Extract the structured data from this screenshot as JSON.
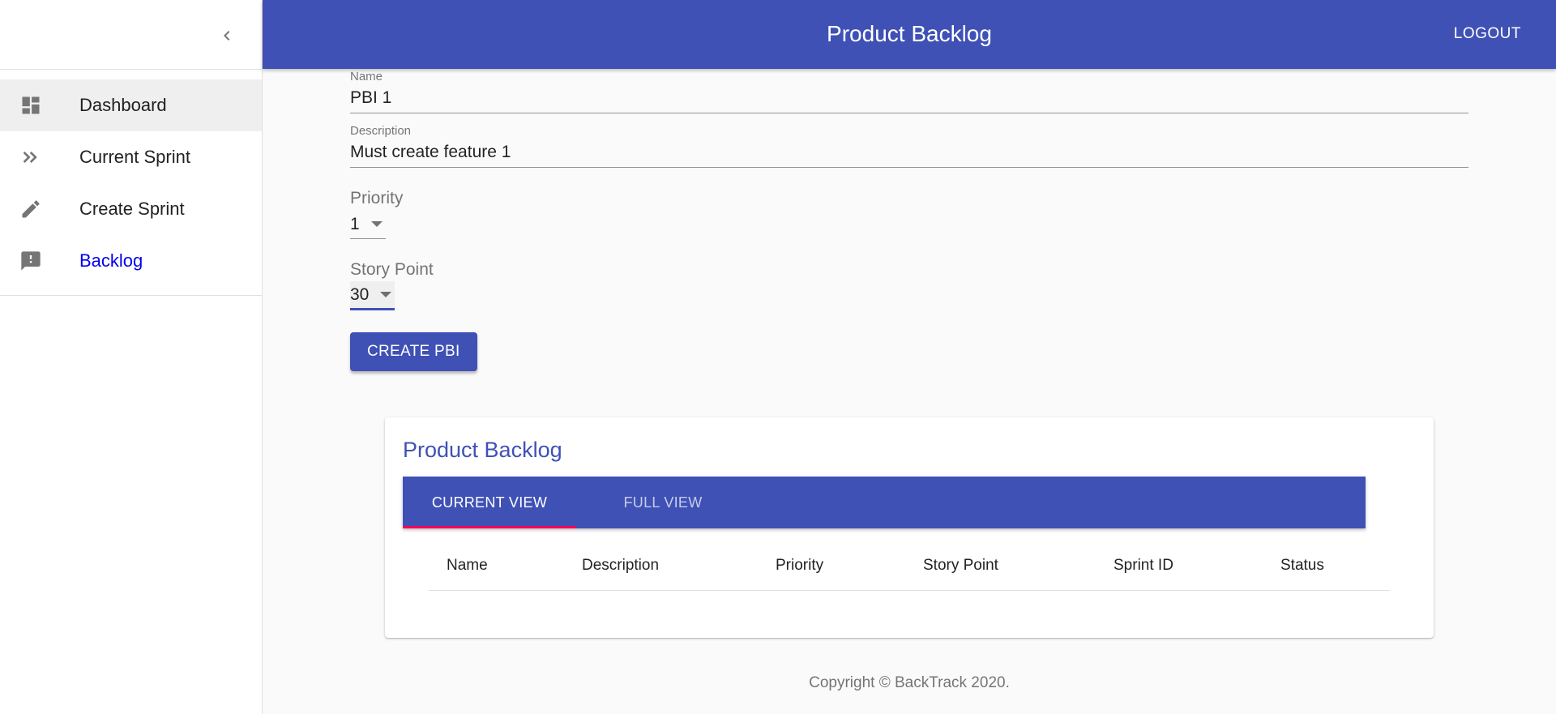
{
  "app": {
    "title": "Product Backlog",
    "logout_label": "LOGOUT"
  },
  "sidebar": {
    "items": [
      {
        "label": "Dashboard",
        "icon": "dashboard-icon"
      },
      {
        "label": "Current Sprint",
        "icon": "double-chevron-icon"
      },
      {
        "label": "Create Sprint",
        "icon": "pencil-icon"
      },
      {
        "label": "Backlog",
        "icon": "feedback-icon"
      }
    ]
  },
  "form": {
    "name_label": "Name",
    "name_value": "PBI 1",
    "description_label": "Description",
    "description_value": "Must create feature 1",
    "priority_label": "Priority",
    "priority_value": "1",
    "story_point_label": "Story Point",
    "story_point_value": "30",
    "create_button": "CREATE PBI"
  },
  "backlog_card": {
    "title": "Product Backlog",
    "tabs": [
      {
        "label": "CURRENT VIEW",
        "active": true
      },
      {
        "label": "FULL VIEW",
        "active": false
      }
    ],
    "columns": [
      "Name",
      "Description",
      "Priority",
      "Story Point",
      "Sprint ID",
      "Status"
    ]
  },
  "footer": {
    "text": "Copyright © BackTrack 2020."
  },
  "colors": {
    "primary": "#3f51b5",
    "accent": "#f50057",
    "link": "#0000ee"
  }
}
